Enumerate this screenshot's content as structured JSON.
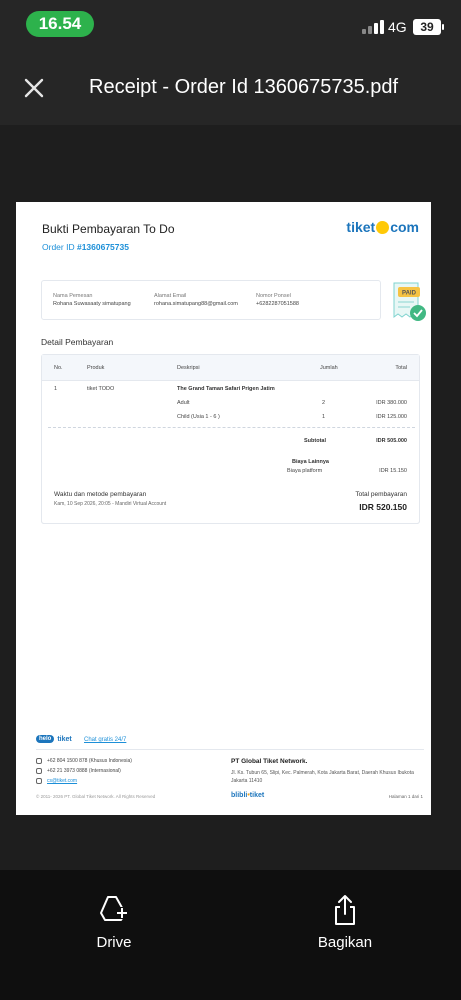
{
  "status_bar": {
    "time": "16.54",
    "network": "4G",
    "battery": "39"
  },
  "app_bar": {
    "title": "Receipt - Order Id 1360675735.pdf",
    "close_icon": "close-icon"
  },
  "receipt": {
    "title": "Bukti Pembayaran To Do",
    "order_label": "Order ID",
    "order_id": "#1360675735",
    "brand_left": "tiket",
    "brand_right": "com",
    "info": {
      "name_label": "Nama Pemesan",
      "name_value": "Rohana Suwasaaty simatupang",
      "email_label": "Alamat Email",
      "email_value": "rohana.simatupang88@gmail.com",
      "phone_label": "Nomor Ponsel",
      "phone_value": "+6282287051588"
    },
    "paid_badge": "PAID",
    "detail_heading": "Detail Pembayaran",
    "columns": [
      "No.",
      "Produk",
      "Deskripsi",
      "Jumlah",
      "Total"
    ],
    "item": {
      "no": "1",
      "product": "tiket TODO",
      "description": "The Grand Taman Safari Prigen Jatim"
    },
    "lines": [
      {
        "desc": "Adult",
        "qty": "2",
        "total": "IDR 380.000"
      },
      {
        "desc": "Child (Usia 1 - 6 )",
        "qty": "1",
        "total": "IDR 125.000"
      }
    ],
    "subtotal_label": "Subtotal",
    "subtotal_value": "IDR 505.000",
    "other_fees_label": "Biaya Lainnya",
    "platform_fee_label": "Biaya platform",
    "platform_fee_value": "IDR 15.150",
    "payment_time_label": "Waktu dan metode pembayaran",
    "payment_time_value": "Kam, 10 Sep 2026, 20:05 - Mandiri Virtual Account",
    "total_label": "Total pembayaran",
    "total_value": "IDR 520.150"
  },
  "footer": {
    "helo": "helo",
    "helo_brand": "tiket",
    "chat": "Chat gratis 24/7",
    "phone1": "+62 804 1500 878 (Khusus Indonesia)",
    "phone2": "+62 21 3973 0888 (Internasional)",
    "email": "cs@tiket.com",
    "company": "PT Global Tiket Network.",
    "address": "Jl. Ks. Tubun 65, Slipi, Kec. Palmerah, Kota Jakarta Barat, Daerah Khusus Ibukota Jakarta 11410",
    "copyright": "© 2011- 2026 PT. Global Tiket Network. All Rights Reserved",
    "blibli": "blibli",
    "blibli_tiket": "tiket",
    "page_no": "Halaman 1 dari 1"
  },
  "bottom_actions": [
    {
      "label": "Drive",
      "icon": "drive-add-icon"
    },
    {
      "label": "Bagikan",
      "icon": "share-icon"
    }
  ],
  "colors": {
    "status_pill": "#2db24c",
    "brand_blue": "#1c75bc",
    "brand_yellow": "#ffc907",
    "background": "#1e1e1e"
  }
}
